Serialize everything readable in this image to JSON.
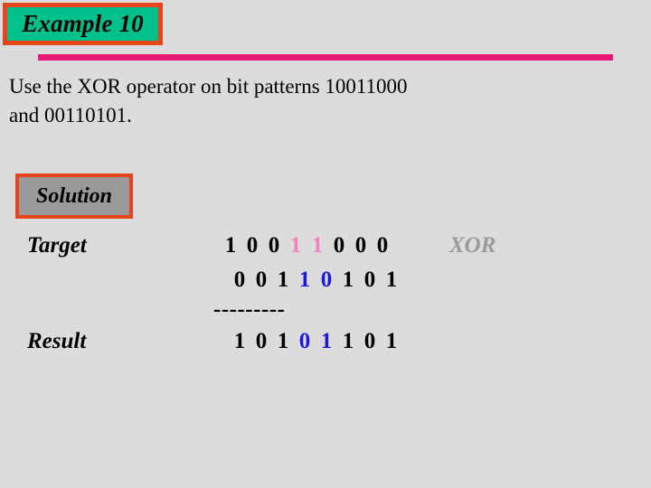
{
  "slide": {
    "background_color": "#dcdcdc",
    "title": {
      "text": "Example 10",
      "fill_color": "#00c18c",
      "border_color": "#e8441c"
    },
    "rule_color": "#e51a70",
    "body": {
      "line1": "Use the XOR operator on bit patterns 10011000",
      "line2": "and 00110101."
    },
    "solution": {
      "text": "Solution",
      "fill_color": "#999999",
      "border_color": "#e8441c"
    },
    "calculation": {
      "operator_label": "XOR",
      "operator_color": "#9a9a9a",
      "separator": "---------",
      "highlight_pink": "#f47ec0",
      "highlight_blue": "#1b16e0",
      "rows": [
        {
          "label": "Target",
          "digits": [
            "1",
            "0",
            "0",
            "1",
            "1",
            "0",
            "0",
            "0"
          ],
          "highlight_indices": [
            3,
            4
          ],
          "highlight_color_name": "pink"
        },
        {
          "label": "",
          "digits": [
            "0",
            "0",
            "1",
            "1",
            "0",
            "1",
            "0",
            "1"
          ],
          "highlight_indices": [
            3,
            4
          ],
          "highlight_color_name": "blue"
        },
        {
          "label": "Result",
          "digits": [
            "1",
            "0",
            "1",
            "0",
            "1",
            "1",
            "0",
            "1"
          ],
          "highlight_indices": [
            3,
            4
          ],
          "highlight_color_name": "blue"
        }
      ]
    }
  }
}
